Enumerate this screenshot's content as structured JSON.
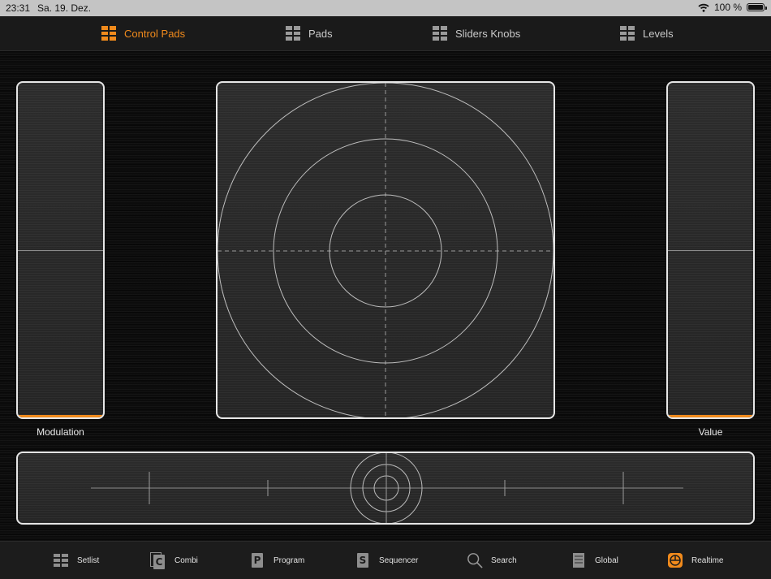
{
  "status_bar": {
    "time": "23:31",
    "date": "Sa. 19. Dez.",
    "battery": "100 %"
  },
  "top_tabs": [
    {
      "label": "Control Pads",
      "active": true
    },
    {
      "label": "Pads",
      "active": false
    },
    {
      "label": "Sliders Knobs",
      "active": false
    },
    {
      "label": "Levels",
      "active": false
    }
  ],
  "left_slider": {
    "label": "Modulation"
  },
  "right_slider": {
    "label": "Value"
  },
  "bottom_nav": [
    {
      "label": "Setlist",
      "icon": "grid-icon"
    },
    {
      "label": "Combi",
      "icon": "combi-icon"
    },
    {
      "label": "Program",
      "icon": "program-icon"
    },
    {
      "label": "Sequencer",
      "icon": "sequencer-icon"
    },
    {
      "label": "Search",
      "icon": "search-icon"
    },
    {
      "label": "Global",
      "icon": "global-icon"
    },
    {
      "label": "Realtime",
      "icon": "realtime-icon"
    }
  ],
  "icon_letters": {
    "combi": "C",
    "program": "P",
    "sequencer": "S"
  },
  "colors": {
    "accent": "#f08a1c",
    "panel_border": "#e6e6e6",
    "inactive_text": "#c9c9c9"
  }
}
